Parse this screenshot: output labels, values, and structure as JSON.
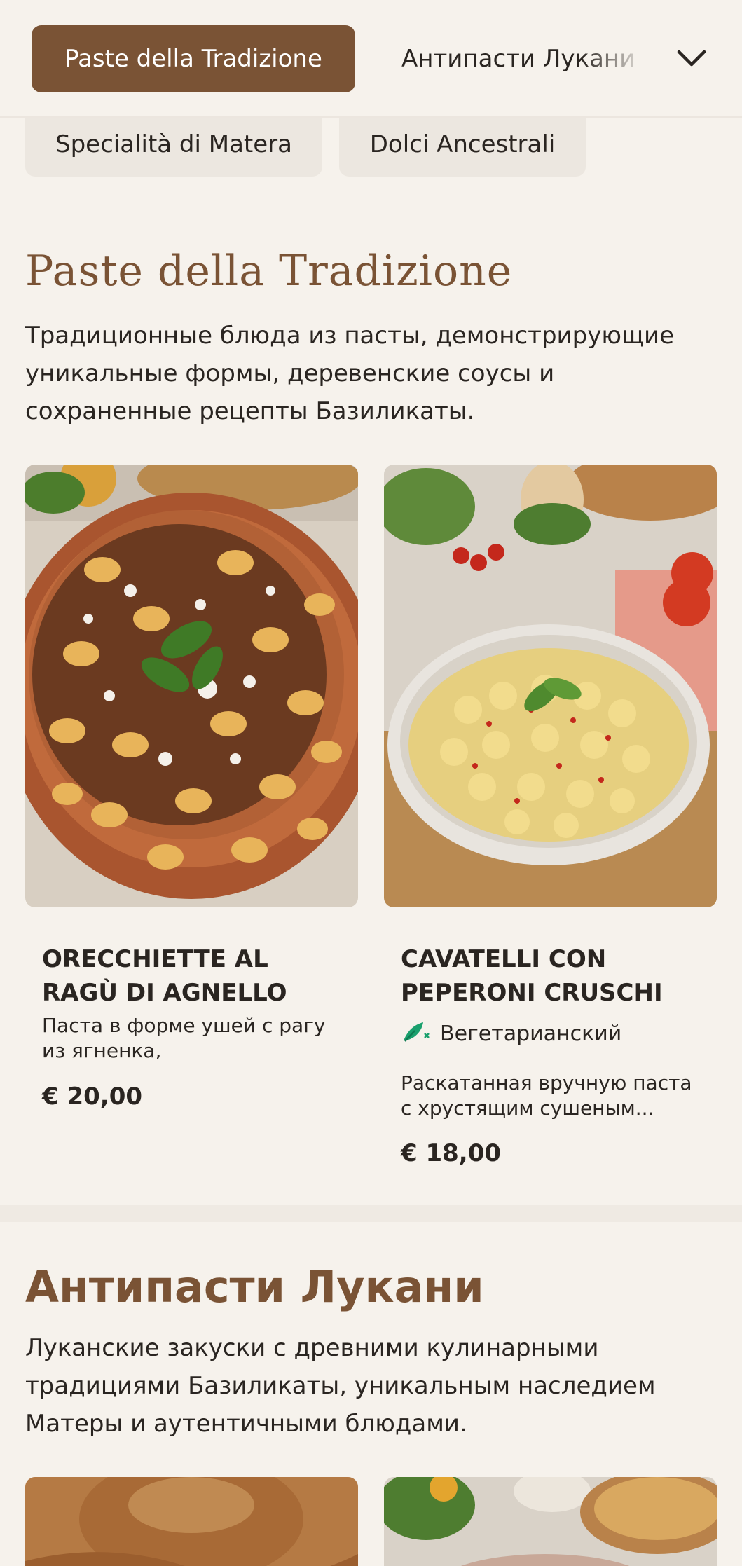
{
  "nav": {
    "active_category": "Paste della Tradizione",
    "next_category": "Антипасти Лукани",
    "more_categories": [
      "Specialità di Matera",
      "Dolci Ancestrali"
    ],
    "expand_icon": "chevron-down-icon"
  },
  "sections": [
    {
      "title": "Paste della Tradizione",
      "description": "Традиционные блюда из пасты, демонстрирующие уникальные формы, деревенские соусы и сохраненные рецепты Базиликаты.",
      "items": [
        {
          "name": "ORECCHIETTE AL RAGÙ DI AGNELLO",
          "description": "Паста в форме ушей с рагу из ягненка, приготовленно...",
          "price": "€ 20,00",
          "image_icon": "pasta-dish-photo"
        },
        {
          "name": "CAVATELLI CON PEPERONI CRUSCHI",
          "tag": "Вегетарианский",
          "tag_icon": "vegetarian-leaf-icon",
          "description": "Раскатанная вручную паста с хрустящим сушеным...",
          "price": "€ 18,00",
          "image_icon": "pasta-bowl-photo"
        }
      ]
    },
    {
      "title": "Антипасти Лукани",
      "description": "Луканские закуски с древними кулинарными традициями Базиликаты, уникальным наследием Матеры и аутентичными блюдами."
    }
  ],
  "colors": {
    "accent": "#7a5335",
    "background": "#f6f2ec",
    "veg_green": "#1aa06d"
  }
}
